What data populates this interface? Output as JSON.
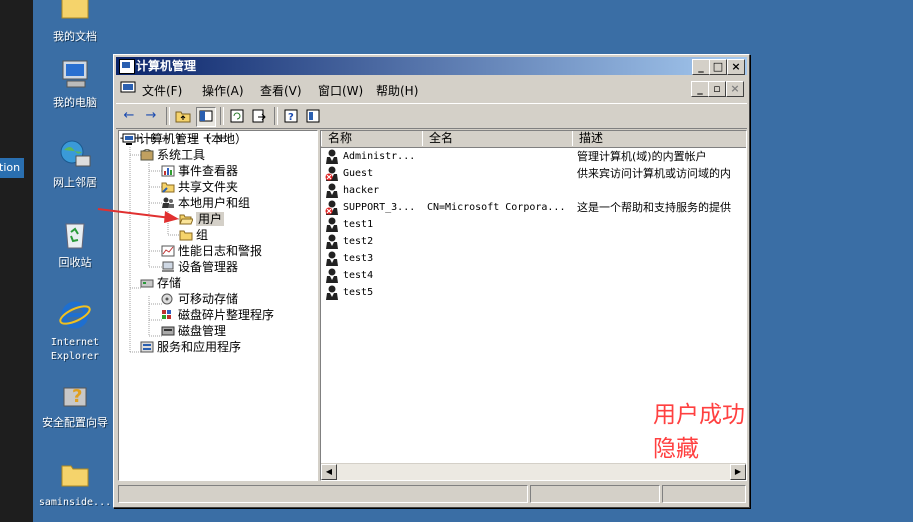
{
  "desktop": {
    "edge_tab": "tion",
    "icons": [
      {
        "label": "我的文档"
      },
      {
        "label": "我的电脑"
      },
      {
        "label": "网上邻居"
      },
      {
        "label": "回收站"
      },
      {
        "label": "Internet Explorer"
      },
      {
        "label": "安全配置向导"
      },
      {
        "label": "saminside..."
      }
    ]
  },
  "window": {
    "title": "计算机管理",
    "menus": [
      {
        "label": "文件(F)"
      },
      {
        "label": "操作(A)"
      },
      {
        "label": "查看(V)"
      },
      {
        "label": "窗口(W)"
      },
      {
        "label": "帮助(H)"
      }
    ],
    "tree": [
      {
        "label": "计算机管理（本地）"
      },
      {
        "label": "系统工具"
      },
      {
        "label": "事件查看器"
      },
      {
        "label": "共享文件夹"
      },
      {
        "label": "本地用户和组"
      },
      {
        "label": "用户"
      },
      {
        "label": "组"
      },
      {
        "label": "性能日志和警报"
      },
      {
        "label": "设备管理器"
      },
      {
        "label": "存储"
      },
      {
        "label": "可移动存储"
      },
      {
        "label": "磁盘碎片整理程序"
      },
      {
        "label": "磁盘管理"
      },
      {
        "label": "服务和应用程序"
      }
    ],
    "columns": {
      "name": "名称",
      "fullname": "全名",
      "desc": "描述"
    },
    "users": [
      {
        "name": "Administr...",
        "fullname": "",
        "desc": "管理计算机(域)的内置帐户",
        "icon": "user-icon"
      },
      {
        "name": "Guest",
        "fullname": "",
        "desc": "供来宾访问计算机或访问域的内",
        "icon": "disabled-user-icon"
      },
      {
        "name": "hacker",
        "fullname": "",
        "desc": "",
        "icon": "user-icon"
      },
      {
        "name": "SUPPORT_3...",
        "fullname": "CN=Microsoft Corpora...",
        "desc": "这是一个帮助和支持服务的提供",
        "icon": "disabled-user-icon"
      },
      {
        "name": "test1",
        "fullname": "",
        "desc": "",
        "icon": "user-icon"
      },
      {
        "name": "test2",
        "fullname": "",
        "desc": "",
        "icon": "user-icon"
      },
      {
        "name": "test3",
        "fullname": "",
        "desc": "",
        "icon": "user-icon"
      },
      {
        "name": "test4",
        "fullname": "",
        "desc": "",
        "icon": "user-icon"
      },
      {
        "name": "test5",
        "fullname": "",
        "desc": "",
        "icon": "user-icon"
      }
    ],
    "annotation": "用户成功隐藏",
    "annotation_color": "#ff4040"
  }
}
